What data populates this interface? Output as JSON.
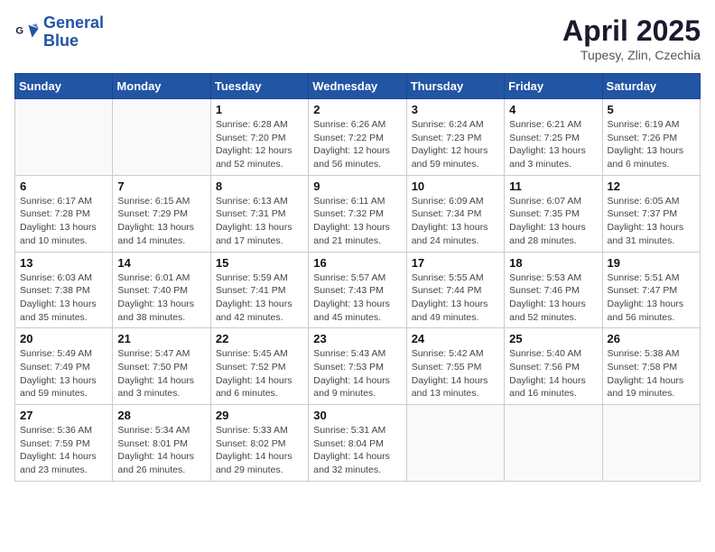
{
  "header": {
    "logo_line1": "General",
    "logo_line2": "Blue",
    "month_year": "April 2025",
    "location": "Tupesy, Zlin, Czechia"
  },
  "days_of_week": [
    "Sunday",
    "Monday",
    "Tuesday",
    "Wednesday",
    "Thursday",
    "Friday",
    "Saturday"
  ],
  "weeks": [
    [
      {
        "day": "",
        "detail": ""
      },
      {
        "day": "",
        "detail": ""
      },
      {
        "day": "1",
        "detail": "Sunrise: 6:28 AM\nSunset: 7:20 PM\nDaylight: 12 hours\nand 52 minutes."
      },
      {
        "day": "2",
        "detail": "Sunrise: 6:26 AM\nSunset: 7:22 PM\nDaylight: 12 hours\nand 56 minutes."
      },
      {
        "day": "3",
        "detail": "Sunrise: 6:24 AM\nSunset: 7:23 PM\nDaylight: 12 hours\nand 59 minutes."
      },
      {
        "day": "4",
        "detail": "Sunrise: 6:21 AM\nSunset: 7:25 PM\nDaylight: 13 hours\nand 3 minutes."
      },
      {
        "day": "5",
        "detail": "Sunrise: 6:19 AM\nSunset: 7:26 PM\nDaylight: 13 hours\nand 6 minutes."
      }
    ],
    [
      {
        "day": "6",
        "detail": "Sunrise: 6:17 AM\nSunset: 7:28 PM\nDaylight: 13 hours\nand 10 minutes."
      },
      {
        "day": "7",
        "detail": "Sunrise: 6:15 AM\nSunset: 7:29 PM\nDaylight: 13 hours\nand 14 minutes."
      },
      {
        "day": "8",
        "detail": "Sunrise: 6:13 AM\nSunset: 7:31 PM\nDaylight: 13 hours\nand 17 minutes."
      },
      {
        "day": "9",
        "detail": "Sunrise: 6:11 AM\nSunset: 7:32 PM\nDaylight: 13 hours\nand 21 minutes."
      },
      {
        "day": "10",
        "detail": "Sunrise: 6:09 AM\nSunset: 7:34 PM\nDaylight: 13 hours\nand 24 minutes."
      },
      {
        "day": "11",
        "detail": "Sunrise: 6:07 AM\nSunset: 7:35 PM\nDaylight: 13 hours\nand 28 minutes."
      },
      {
        "day": "12",
        "detail": "Sunrise: 6:05 AM\nSunset: 7:37 PM\nDaylight: 13 hours\nand 31 minutes."
      }
    ],
    [
      {
        "day": "13",
        "detail": "Sunrise: 6:03 AM\nSunset: 7:38 PM\nDaylight: 13 hours\nand 35 minutes."
      },
      {
        "day": "14",
        "detail": "Sunrise: 6:01 AM\nSunset: 7:40 PM\nDaylight: 13 hours\nand 38 minutes."
      },
      {
        "day": "15",
        "detail": "Sunrise: 5:59 AM\nSunset: 7:41 PM\nDaylight: 13 hours\nand 42 minutes."
      },
      {
        "day": "16",
        "detail": "Sunrise: 5:57 AM\nSunset: 7:43 PM\nDaylight: 13 hours\nand 45 minutes."
      },
      {
        "day": "17",
        "detail": "Sunrise: 5:55 AM\nSunset: 7:44 PM\nDaylight: 13 hours\nand 49 minutes."
      },
      {
        "day": "18",
        "detail": "Sunrise: 5:53 AM\nSunset: 7:46 PM\nDaylight: 13 hours\nand 52 minutes."
      },
      {
        "day": "19",
        "detail": "Sunrise: 5:51 AM\nSunset: 7:47 PM\nDaylight: 13 hours\nand 56 minutes."
      }
    ],
    [
      {
        "day": "20",
        "detail": "Sunrise: 5:49 AM\nSunset: 7:49 PM\nDaylight: 13 hours\nand 59 minutes."
      },
      {
        "day": "21",
        "detail": "Sunrise: 5:47 AM\nSunset: 7:50 PM\nDaylight: 14 hours\nand 3 minutes."
      },
      {
        "day": "22",
        "detail": "Sunrise: 5:45 AM\nSunset: 7:52 PM\nDaylight: 14 hours\nand 6 minutes."
      },
      {
        "day": "23",
        "detail": "Sunrise: 5:43 AM\nSunset: 7:53 PM\nDaylight: 14 hours\nand 9 minutes."
      },
      {
        "day": "24",
        "detail": "Sunrise: 5:42 AM\nSunset: 7:55 PM\nDaylight: 14 hours\nand 13 minutes."
      },
      {
        "day": "25",
        "detail": "Sunrise: 5:40 AM\nSunset: 7:56 PM\nDaylight: 14 hours\nand 16 minutes."
      },
      {
        "day": "26",
        "detail": "Sunrise: 5:38 AM\nSunset: 7:58 PM\nDaylight: 14 hours\nand 19 minutes."
      }
    ],
    [
      {
        "day": "27",
        "detail": "Sunrise: 5:36 AM\nSunset: 7:59 PM\nDaylight: 14 hours\nand 23 minutes."
      },
      {
        "day": "28",
        "detail": "Sunrise: 5:34 AM\nSunset: 8:01 PM\nDaylight: 14 hours\nand 26 minutes."
      },
      {
        "day": "29",
        "detail": "Sunrise: 5:33 AM\nSunset: 8:02 PM\nDaylight: 14 hours\nand 29 minutes."
      },
      {
        "day": "30",
        "detail": "Sunrise: 5:31 AM\nSunset: 8:04 PM\nDaylight: 14 hours\nand 32 minutes."
      },
      {
        "day": "",
        "detail": ""
      },
      {
        "day": "",
        "detail": ""
      },
      {
        "day": "",
        "detail": ""
      }
    ]
  ]
}
